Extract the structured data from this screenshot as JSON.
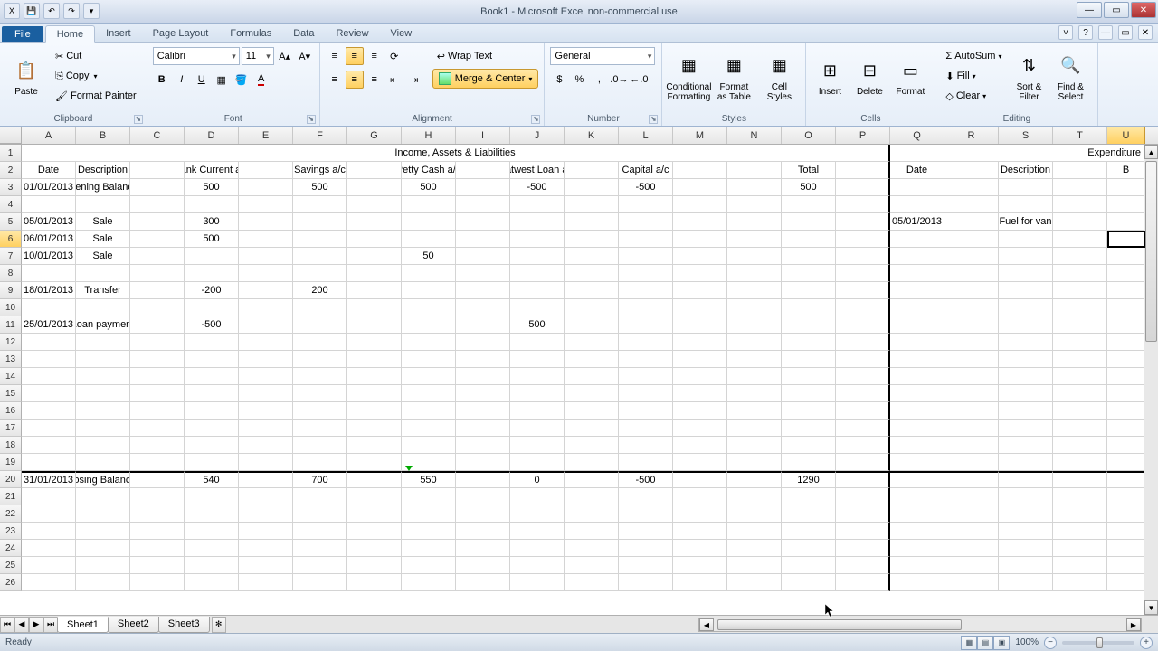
{
  "titlebar": {
    "title": "Book1 - Microsoft Excel non-commercial use"
  },
  "tabs": {
    "file": "File",
    "items": [
      "Home",
      "Insert",
      "Page Layout",
      "Formulas",
      "Data",
      "Review",
      "View"
    ],
    "active": "Home"
  },
  "ribbon": {
    "clipboard": {
      "label": "Clipboard",
      "paste": "Paste",
      "cut": "Cut",
      "copy": "Copy",
      "format_painter": "Format Painter"
    },
    "font": {
      "label": "Font",
      "name": "Calibri",
      "size": "11"
    },
    "alignment": {
      "label": "Alignment",
      "wrap": "Wrap Text",
      "merge": "Merge & Center"
    },
    "number": {
      "label": "Number",
      "format": "General"
    },
    "styles": {
      "label": "Styles",
      "cond": "Conditional Formatting",
      "table": "Format as Table",
      "cell": "Cell Styles"
    },
    "cells": {
      "label": "Cells",
      "insert": "Insert",
      "delete": "Delete",
      "format": "Format"
    },
    "editing": {
      "label": "Editing",
      "autosum": "AutoSum",
      "fill": "Fill",
      "clear": "Clear",
      "sort": "Sort & Filter",
      "find": "Find & Select"
    }
  },
  "columns": [
    {
      "l": "A",
      "w": 60
    },
    {
      "l": "B",
      "w": 60
    },
    {
      "l": "C",
      "w": 60
    },
    {
      "l": "D",
      "w": 60
    },
    {
      "l": "E",
      "w": 60
    },
    {
      "l": "F",
      "w": 60
    },
    {
      "l": "G",
      "w": 60
    },
    {
      "l": "H",
      "w": 60
    },
    {
      "l": "I",
      "w": 60
    },
    {
      "l": "J",
      "w": 60
    },
    {
      "l": "K",
      "w": 60
    },
    {
      "l": "L",
      "w": 60
    },
    {
      "l": "M",
      "w": 60
    },
    {
      "l": "N",
      "w": 60
    },
    {
      "l": "O",
      "w": 60
    },
    {
      "l": "P",
      "w": 60
    },
    {
      "l": "Q",
      "w": 60
    },
    {
      "l": "R",
      "w": 60
    },
    {
      "l": "S",
      "w": 60
    },
    {
      "l": "T",
      "w": 60
    },
    {
      "l": "U",
      "w": 42
    }
  ],
  "active_col": "U",
  "active_row": 6,
  "headers": {
    "section1": "Income, Assets & Liabilities",
    "section2": "Expenditure",
    "row2": [
      "Date",
      "Description",
      "",
      "Bank Current a/c",
      "",
      "Savings a/c",
      "",
      "Petty Cash a/c",
      "",
      "Natwest Loan a/c",
      "",
      "Capital a/c",
      "",
      "",
      "Total",
      "",
      "Date",
      "",
      "Description",
      "",
      "B"
    ]
  },
  "data_rows": [
    {
      "r": 3,
      "cells": [
        "01/01/2013",
        "Opening Balances",
        "",
        "500",
        "",
        "500",
        "",
        "500",
        "",
        "-500",
        "",
        "-500",
        "",
        "",
        "500",
        "",
        "",
        "",
        "",
        "",
        ""
      ]
    },
    {
      "r": 4,
      "cells": [
        "",
        "",
        "",
        "",
        "",
        "",
        "",
        "",
        "",
        "",
        "",
        "",
        "",
        "",
        "",
        "",
        "",
        "",
        "",
        "",
        ""
      ]
    },
    {
      "r": 5,
      "cells": [
        "05/01/2013",
        "Sale",
        "",
        "300",
        "",
        "",
        "",
        "",
        "",
        "",
        "",
        "",
        "",
        "",
        "",
        "",
        "05/01/2013",
        "",
        "Fuel for van",
        "",
        ""
      ]
    },
    {
      "r": 6,
      "cells": [
        "06/01/2013",
        "Sale",
        "",
        "500",
        "",
        "",
        "",
        "",
        "",
        "",
        "",
        "",
        "",
        "",
        "",
        "",
        "",
        "",
        "",
        "",
        ""
      ]
    },
    {
      "r": 7,
      "cells": [
        "10/01/2013",
        "Sale",
        "",
        "",
        "",
        "",
        "",
        "50",
        "",
        "",
        "",
        "",
        "",
        "",
        "",
        "",
        "",
        "",
        "",
        "",
        ""
      ]
    },
    {
      "r": 8,
      "cells": [
        "",
        "",
        "",
        "",
        "",
        "",
        "",
        "",
        "",
        "",
        "",
        "",
        "",
        "",
        "",
        "",
        "",
        "",
        "",
        "",
        ""
      ]
    },
    {
      "r": 9,
      "cells": [
        "18/01/2013",
        "Transfer",
        "",
        "-200",
        "",
        "200",
        "",
        "",
        "",
        "",
        "",
        "",
        "",
        "",
        "",
        "",
        "",
        "",
        "",
        "",
        ""
      ]
    },
    {
      "r": 10,
      "cells": [
        "",
        "",
        "",
        "",
        "",
        "",
        "",
        "",
        "",
        "",
        "",
        "",
        "",
        "",
        "",
        "",
        "",
        "",
        "",
        "",
        ""
      ]
    },
    {
      "r": 11,
      "cells": [
        "25/01/2013",
        "Loan payment",
        "",
        "-500",
        "",
        "",
        "",
        "",
        "",
        "500",
        "",
        "",
        "",
        "",
        "",
        "",
        "",
        "",
        "",
        "",
        ""
      ]
    }
  ],
  "closing": {
    "r": 20,
    "cells": [
      "31/01/2013",
      "Closing Balances",
      "",
      "540",
      "",
      "700",
      "",
      "550",
      "",
      "0",
      "",
      "-500",
      "",
      "",
      "1290",
      "",
      "",
      "",
      "",
      "",
      ""
    ]
  },
  "sheets": [
    "Sheet1",
    "Sheet2",
    "Sheet3"
  ],
  "active_sheet": "Sheet1",
  "status": {
    "ready": "Ready",
    "zoom": "100%"
  }
}
